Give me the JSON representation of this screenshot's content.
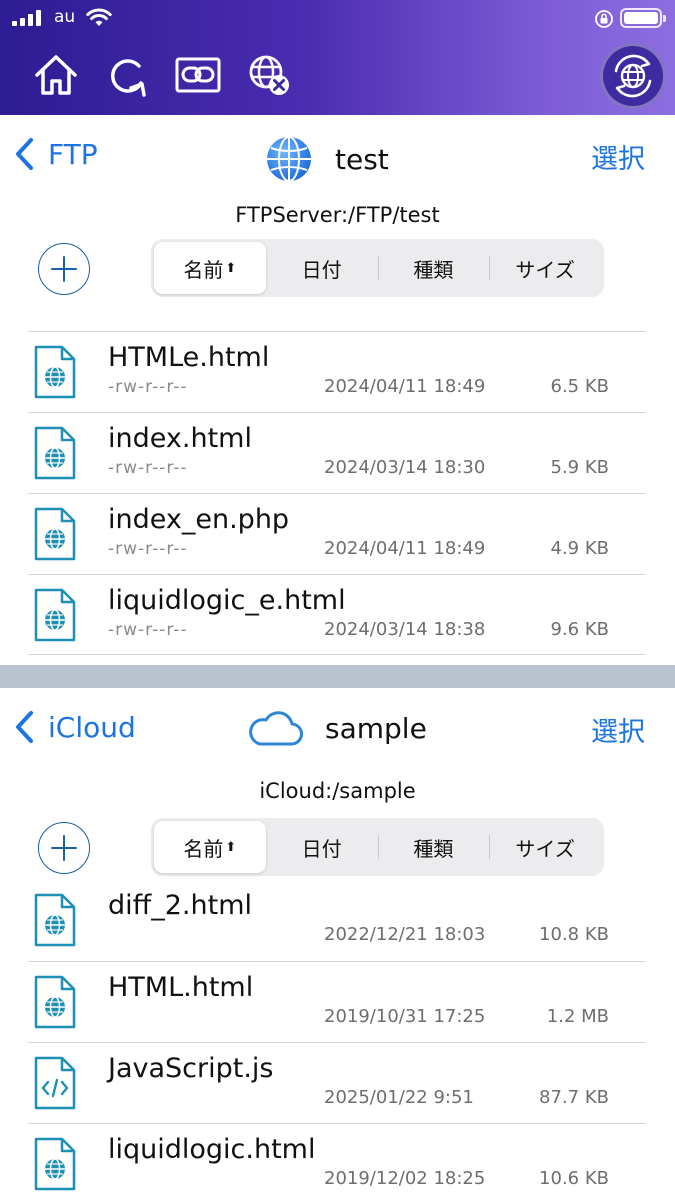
{
  "status": {
    "carrier": "au"
  },
  "toolbar": {
    "icons": [
      "home-icon",
      "refresh-icon",
      "link-icon",
      "globe-disconnect-icon",
      "globe-sync-icon"
    ]
  },
  "ftp_panel": {
    "back_label": "FTP",
    "title": "test",
    "select_label": "選択",
    "path": "FTPServer:/FTP/test",
    "sort": {
      "name": "名前",
      "date": "日付",
      "kind": "種類",
      "size": "サイズ",
      "arrow": "⬆"
    },
    "files": [
      {
        "name": "HTMLe.html",
        "perm": "-rw-r--r--",
        "date": "2024/04/11 18:49",
        "size": "6.5 KB",
        "icon": "html-file-icon"
      },
      {
        "name": "index.html",
        "perm": "-rw-r--r--",
        "date": "2024/03/14 18:30",
        "size": "5.9 KB",
        "icon": "html-file-icon"
      },
      {
        "name": "index_en.php",
        "perm": "-rw-r--r--",
        "date": "2024/04/11 18:49",
        "size": "4.9 KB",
        "icon": "html-file-icon"
      },
      {
        "name": "liquidlogic_e.html",
        "perm": "-rw-r--r--",
        "date": "2024/03/14 18:38",
        "size": "9.6 KB",
        "icon": "html-file-icon"
      }
    ]
  },
  "icloud_panel": {
    "back_label": "iCloud",
    "title": "sample",
    "select_label": "選択",
    "path": "iCloud:/sample",
    "sort": {
      "name": "名前",
      "date": "日付",
      "kind": "種類",
      "size": "サイズ",
      "arrow": "⬆"
    },
    "files": [
      {
        "name": "diff_2.html",
        "date": "2022/12/21 18:03",
        "size": "10.8 KB",
        "icon": "html-file-icon"
      },
      {
        "name": "HTML.html",
        "date": "2019/10/31 17:25",
        "size": "1.2 MB",
        "icon": "html-file-icon"
      },
      {
        "name": "JavaScript.js",
        "date": "2025/01/22  9:51",
        "size": "87.7 KB",
        "icon": "code-file-icon"
      },
      {
        "name": "liquidlogic.html",
        "date": "2019/12/02 18:25",
        "size": "10.6 KB",
        "icon": "html-file-icon"
      }
    ]
  },
  "colors": {
    "accent": "#1c74e0",
    "file_icon": "#1f8fb5",
    "gradient_start": "#2d1c93",
    "gradient_end": "#8d6ee0"
  }
}
